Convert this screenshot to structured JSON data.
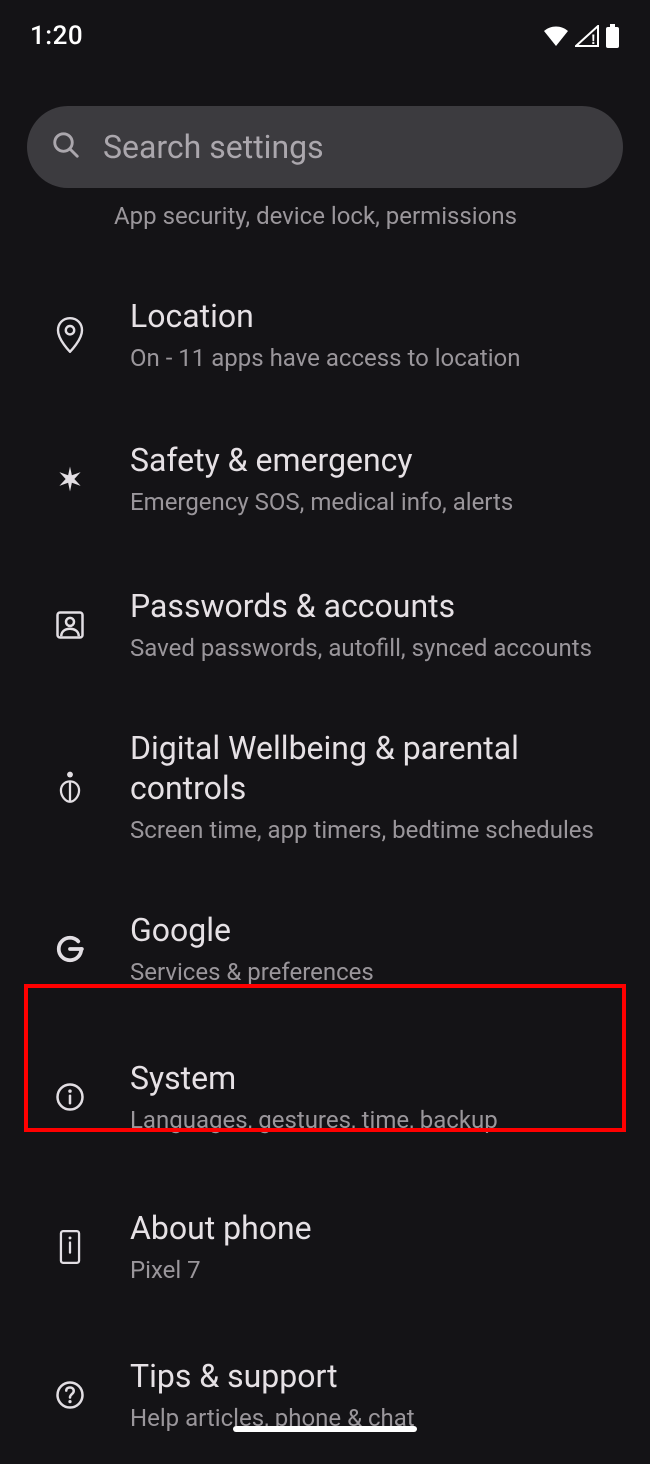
{
  "status": {
    "time": "1:20"
  },
  "search": {
    "placeholder": "Search settings"
  },
  "partial": {
    "sub": "App security, device lock, permissions"
  },
  "rows": {
    "location": {
      "title": "Location",
      "sub": "On - 11 apps have access to location"
    },
    "safety": {
      "title": "Safety & emergency",
      "sub": "Emergency SOS, medical info, alerts"
    },
    "passwords": {
      "title": "Passwords & accounts",
      "sub": "Saved passwords, autofill, synced accounts"
    },
    "dwb": {
      "title": "Digital Wellbeing & parental controls",
      "sub": "Screen time, app timers, bedtime schedules"
    },
    "google": {
      "title": "Google",
      "sub": "Services & preferences"
    },
    "system": {
      "title": "System",
      "sub": "Languages, gestures, time, backup"
    },
    "about": {
      "title": "About phone",
      "sub": "Pixel 7"
    },
    "tips": {
      "title": "Tips & support",
      "sub": "Help articles, phone & chat"
    }
  }
}
